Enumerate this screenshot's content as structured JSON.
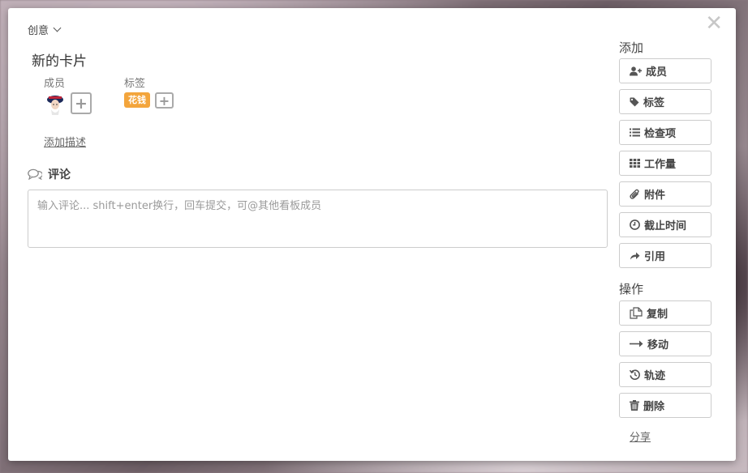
{
  "board": {
    "name": "创意",
    "close_icon": "close-icon"
  },
  "card": {
    "title": "新的卡片",
    "members_label": "成员",
    "labels_label": "标签",
    "label_tag": {
      "text": "花钱",
      "color": "#f3a53c"
    },
    "add_description": "添加描述"
  },
  "comment": {
    "title": "评论",
    "placeholder": "输入评论... shift+enter换行，回车提交，可@其他看板成员"
  },
  "sidebar": {
    "add_title": "添加",
    "add_items": [
      {
        "label": "成员",
        "icon": "user-plus-icon"
      },
      {
        "label": "标签",
        "icon": "tag-icon"
      },
      {
        "label": "检查项",
        "icon": "list-icon"
      },
      {
        "label": "工作量",
        "icon": "grid-icon"
      },
      {
        "label": "附件",
        "icon": "paperclip-icon"
      },
      {
        "label": "截止时间",
        "icon": "clock-icon"
      },
      {
        "label": "引用",
        "icon": "share-arrow-icon"
      }
    ],
    "actions_title": "操作",
    "action_items": [
      {
        "label": "复制",
        "icon": "copy-icon"
      },
      {
        "label": "移动",
        "icon": "arrow-right-icon"
      },
      {
        "label": "轨迹",
        "icon": "history-icon"
      },
      {
        "label": "删除",
        "icon": "trash-icon"
      }
    ],
    "share": "分享"
  }
}
